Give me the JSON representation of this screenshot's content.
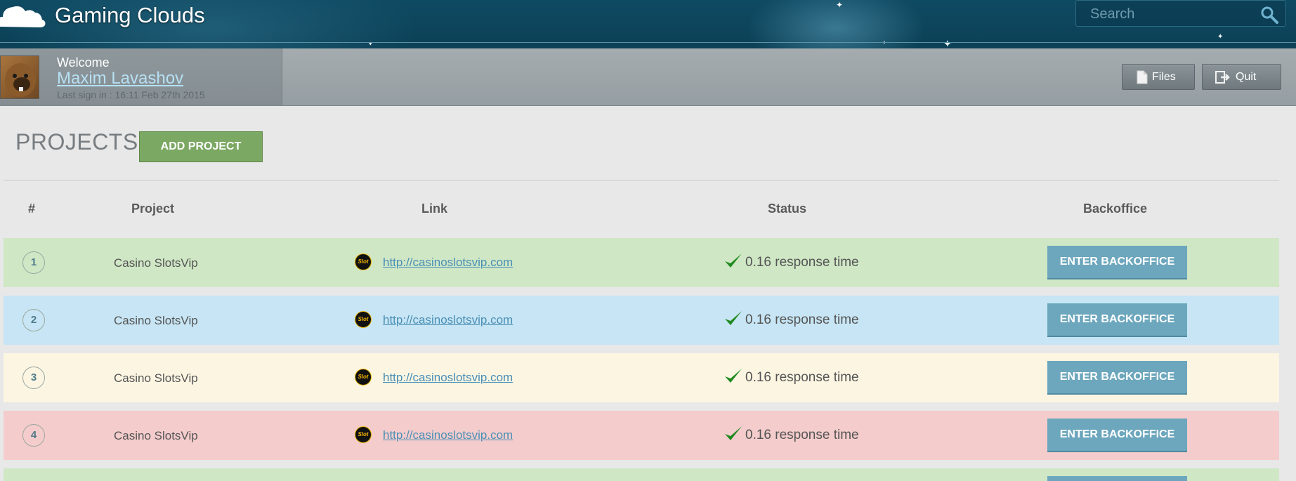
{
  "header": {
    "brand": "Gaming Clouds",
    "search_placeholder": "Search"
  },
  "user": {
    "welcome": "Welcome",
    "name": "Maxim Lavashov",
    "last_sign": "Last sign in : 16:11 Feb 27th 2015",
    "files_label": "Files",
    "quit_label": "Quit"
  },
  "projects": {
    "title": "PROJECTS",
    "add_label": "ADD PROJECT",
    "columns": [
      "#",
      "Project",
      "Link",
      "Status",
      "Backoffice"
    ],
    "rows": [
      {
        "num": "1",
        "name": "Casino SlotsVip",
        "icon_text": "Slot",
        "link": "http://casinoslotsvip.com",
        "status": "0.16 response time",
        "action": "ENTER BACKOFFICE",
        "color": "#cfe7c5"
      },
      {
        "num": "2",
        "name": "Casino SlotsVip",
        "icon_text": "Slot",
        "link": "http://casinoslotsvip.com",
        "status": "0.16 response time",
        "action": "ENTER BACKOFFICE",
        "color": "#c7e5f4"
      },
      {
        "num": "3",
        "name": "Casino SlotsVip",
        "icon_text": "Slot",
        "link": "http://casinoslotsvip.com",
        "status": "0.16 response time",
        "action": "ENTER BACKOFFICE",
        "color": "#fbf5e2"
      },
      {
        "num": "4",
        "name": "Casino SlotsVip",
        "icon_text": "Slot",
        "link": "http://casinoslotsvip.com",
        "status": "0.16 response time",
        "action": "ENTER BACKOFFICE",
        "color": "#f4cccc"
      }
    ],
    "partial_row_color": "#cfe7c5",
    "partial_button_color": "#6da7bd"
  },
  "colors": {
    "header_bg": "#0e4a62",
    "add_button": "#7ba862",
    "enter_button": "#6da7bd",
    "check": "#1f8a1f"
  }
}
